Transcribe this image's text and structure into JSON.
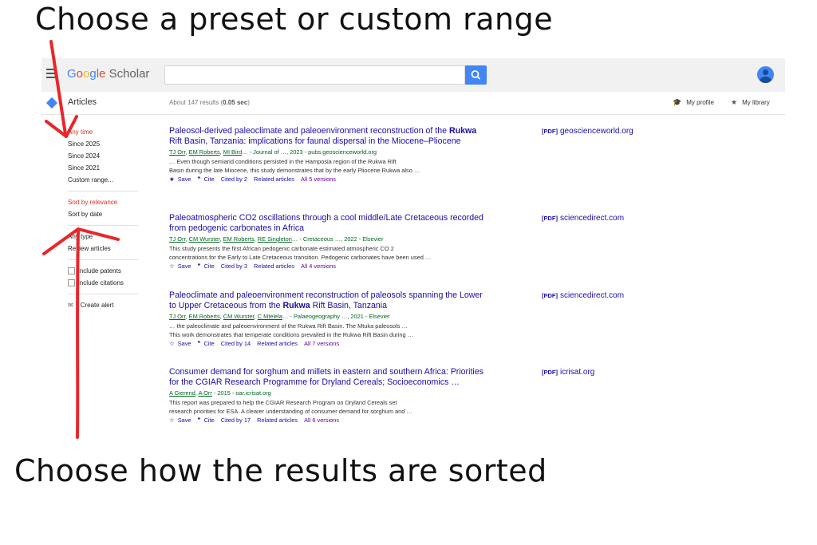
{
  "captions": {
    "top": "Choose a preset or custom range",
    "bottom": "Choose how the results are sorted"
  },
  "header": {
    "logo_google": "Google",
    "logo_scholar": "Scholar",
    "search_value": "",
    "section": "Articles",
    "results_prefix": "About 147 results (",
    "results_time": "0.05 sec",
    "results_suffix": ")",
    "my_profile": "My profile",
    "my_library": "My library"
  },
  "sidebar": {
    "time": [
      "Any time",
      "Since 2025",
      "Since 2024",
      "Since 2021",
      "Custom range..."
    ],
    "sort": [
      "Sort by relevance",
      "Sort by date"
    ],
    "type": [
      "Any type",
      "Review articles"
    ],
    "checks": [
      "include patents",
      "include citations"
    ],
    "create_alert": "Create alert"
  },
  "results": [
    {
      "title_parts": [
        "Paleosol-derived paleoclimate and paleoenvironment reconstruction of the ",
        "Rukwa",
        " Rift Basin, Tanzania: implications for faunal dispersal in the Miocene–Pliocene"
      ],
      "authors": [
        "TJ Orr",
        "EM Roberts",
        "MI Bird"
      ],
      "source": "… - Journal of …, 2023 - pubs.geoscienceworld.org",
      "snippet1": "… Even though semiarid conditions persisted in the Hamposia region of the Rukwa Rift",
      "snippet2": "Basin during the late Miocene, this study demonstrates that by the early Pliocene Rukwa also …",
      "save": "Save",
      "cite": "Cite",
      "cited": "Cited by 2",
      "related": "Related articles",
      "versions": "All 5 versions",
      "pdf_tag": "[PDF]",
      "pdf_domain": "geoscienceworld.org"
    },
    {
      "title_parts": [
        "Paleoatmospheric CO2 oscillations through a cool middle/Late Cretaceous recorded from pedogenic carbonates in Africa",
        "",
        ""
      ],
      "authors": [
        "TJ Orr",
        "CM Wurster",
        "EM Roberts",
        "RE Singleton"
      ],
      "source": "… - Cretaceous …, 2022 - Elsevier",
      "snippet1": "This study presents the first African pedogenic carbonate estimated atmospheric CO 2",
      "snippet2": "concentrations for the Early to Late Cretaceous transition. Pedogenic carbonates have been used …",
      "save": "Save",
      "cite": "Cite",
      "cited": "Cited by 3",
      "related": "Related articles",
      "versions": "All 4 versions",
      "pdf_tag": "[PDF]",
      "pdf_domain": "sciencedirect.com"
    },
    {
      "title_parts": [
        "Paleoclimate and paleoenvironment reconstruction of paleosols spanning the Lower to Upper Cretaceous from the ",
        "Rukwa",
        " Rift Basin, Tanzania"
      ],
      "authors": [
        "TJ Orr",
        "EM Roberts",
        "CM Wurster",
        "C Mtelela"
      ],
      "source": "… - Palaeogeography …, 2021 - Elsevier",
      "snippet1": "… the paleoclimate and paleoenvironment of the Rukwa Rift Basin. The Mtuka paleosols …",
      "snippet2": "This work demonstrates that temperate conditions prevailed in the Rukwa Rift Basin during …",
      "save": "Save",
      "cite": "Cite",
      "cited": "Cited by 14",
      "related": "Related articles",
      "versions": "All 7 versions",
      "pdf_tag": "[PDF]",
      "pdf_domain": "sciencedirect.com"
    },
    {
      "title_parts": [
        "Consumer demand for sorghum and millets in eastern and southern Africa: Priorities for the CGIAR Research Programme for Dryland Cereals; Socioeconomics …",
        "",
        ""
      ],
      "authors": [
        "A Gierend",
        "A Orr"
      ],
      "source": " - 2015 - oar.icrisat.org",
      "snippet1": "This report was prepared to help the CGIAR Research Program on Dryland Cereals set",
      "snippet2": "research priorities for ESA. A clearer understanding of consumer demand for sorghum and …",
      "save": "Save",
      "cite": "Cite",
      "cited": "Cited by 17",
      "related": "Related articles",
      "versions": "All 6 versions",
      "pdf_tag": "[PDF]",
      "pdf_domain": "icrisat.org"
    }
  ],
  "colors": {
    "annotation_arrow": "#e8262b",
    "link": "#1a0dab",
    "accent": "#4285f4"
  }
}
